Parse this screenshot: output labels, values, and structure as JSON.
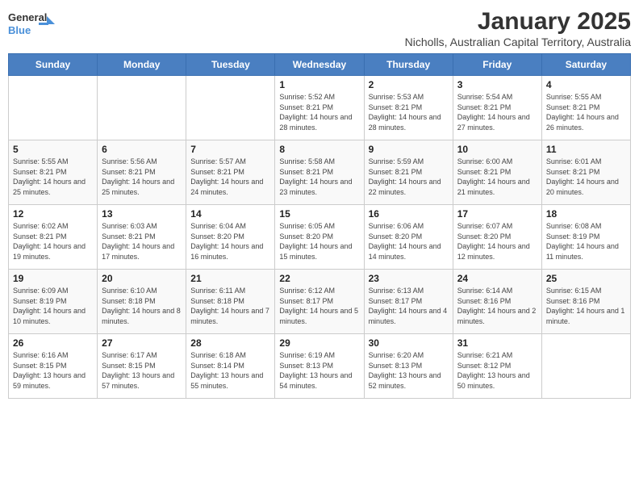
{
  "header": {
    "logo_line1": "General",
    "logo_line2": "Blue",
    "title": "January 2025",
    "subtitle": "Nicholls, Australian Capital Territory, Australia"
  },
  "days_of_week": [
    "Sunday",
    "Monday",
    "Tuesday",
    "Wednesday",
    "Thursday",
    "Friday",
    "Saturday"
  ],
  "weeks": [
    [
      {
        "num": "",
        "info": ""
      },
      {
        "num": "",
        "info": ""
      },
      {
        "num": "",
        "info": ""
      },
      {
        "num": "1",
        "info": "Sunrise: 5:52 AM\nSunset: 8:21 PM\nDaylight: 14 hours\nand 28 minutes."
      },
      {
        "num": "2",
        "info": "Sunrise: 5:53 AM\nSunset: 8:21 PM\nDaylight: 14 hours\nand 28 minutes."
      },
      {
        "num": "3",
        "info": "Sunrise: 5:54 AM\nSunset: 8:21 PM\nDaylight: 14 hours\nand 27 minutes."
      },
      {
        "num": "4",
        "info": "Sunrise: 5:55 AM\nSunset: 8:21 PM\nDaylight: 14 hours\nand 26 minutes."
      }
    ],
    [
      {
        "num": "5",
        "info": "Sunrise: 5:55 AM\nSunset: 8:21 PM\nDaylight: 14 hours\nand 25 minutes."
      },
      {
        "num": "6",
        "info": "Sunrise: 5:56 AM\nSunset: 8:21 PM\nDaylight: 14 hours\nand 25 minutes."
      },
      {
        "num": "7",
        "info": "Sunrise: 5:57 AM\nSunset: 8:21 PM\nDaylight: 14 hours\nand 24 minutes."
      },
      {
        "num": "8",
        "info": "Sunrise: 5:58 AM\nSunset: 8:21 PM\nDaylight: 14 hours\nand 23 minutes."
      },
      {
        "num": "9",
        "info": "Sunrise: 5:59 AM\nSunset: 8:21 PM\nDaylight: 14 hours\nand 22 minutes."
      },
      {
        "num": "10",
        "info": "Sunrise: 6:00 AM\nSunset: 8:21 PM\nDaylight: 14 hours\nand 21 minutes."
      },
      {
        "num": "11",
        "info": "Sunrise: 6:01 AM\nSunset: 8:21 PM\nDaylight: 14 hours\nand 20 minutes."
      }
    ],
    [
      {
        "num": "12",
        "info": "Sunrise: 6:02 AM\nSunset: 8:21 PM\nDaylight: 14 hours\nand 19 minutes."
      },
      {
        "num": "13",
        "info": "Sunrise: 6:03 AM\nSunset: 8:21 PM\nDaylight: 14 hours\nand 17 minutes."
      },
      {
        "num": "14",
        "info": "Sunrise: 6:04 AM\nSunset: 8:20 PM\nDaylight: 14 hours\nand 16 minutes."
      },
      {
        "num": "15",
        "info": "Sunrise: 6:05 AM\nSunset: 8:20 PM\nDaylight: 14 hours\nand 15 minutes."
      },
      {
        "num": "16",
        "info": "Sunrise: 6:06 AM\nSunset: 8:20 PM\nDaylight: 14 hours\nand 14 minutes."
      },
      {
        "num": "17",
        "info": "Sunrise: 6:07 AM\nSunset: 8:20 PM\nDaylight: 14 hours\nand 12 minutes."
      },
      {
        "num": "18",
        "info": "Sunrise: 6:08 AM\nSunset: 8:19 PM\nDaylight: 14 hours\nand 11 minutes."
      }
    ],
    [
      {
        "num": "19",
        "info": "Sunrise: 6:09 AM\nSunset: 8:19 PM\nDaylight: 14 hours\nand 10 minutes."
      },
      {
        "num": "20",
        "info": "Sunrise: 6:10 AM\nSunset: 8:18 PM\nDaylight: 14 hours\nand 8 minutes."
      },
      {
        "num": "21",
        "info": "Sunrise: 6:11 AM\nSunset: 8:18 PM\nDaylight: 14 hours\nand 7 minutes."
      },
      {
        "num": "22",
        "info": "Sunrise: 6:12 AM\nSunset: 8:17 PM\nDaylight: 14 hours\nand 5 minutes."
      },
      {
        "num": "23",
        "info": "Sunrise: 6:13 AM\nSunset: 8:17 PM\nDaylight: 14 hours\nand 4 minutes."
      },
      {
        "num": "24",
        "info": "Sunrise: 6:14 AM\nSunset: 8:16 PM\nDaylight: 14 hours\nand 2 minutes."
      },
      {
        "num": "25",
        "info": "Sunrise: 6:15 AM\nSunset: 8:16 PM\nDaylight: 14 hours\nand 1 minute."
      }
    ],
    [
      {
        "num": "26",
        "info": "Sunrise: 6:16 AM\nSunset: 8:15 PM\nDaylight: 13 hours\nand 59 minutes."
      },
      {
        "num": "27",
        "info": "Sunrise: 6:17 AM\nSunset: 8:15 PM\nDaylight: 13 hours\nand 57 minutes."
      },
      {
        "num": "28",
        "info": "Sunrise: 6:18 AM\nSunset: 8:14 PM\nDaylight: 13 hours\nand 55 minutes."
      },
      {
        "num": "29",
        "info": "Sunrise: 6:19 AM\nSunset: 8:13 PM\nDaylight: 13 hours\nand 54 minutes."
      },
      {
        "num": "30",
        "info": "Sunrise: 6:20 AM\nSunset: 8:13 PM\nDaylight: 13 hours\nand 52 minutes."
      },
      {
        "num": "31",
        "info": "Sunrise: 6:21 AM\nSunset: 8:12 PM\nDaylight: 13 hours\nand 50 minutes."
      },
      {
        "num": "",
        "info": ""
      }
    ]
  ]
}
